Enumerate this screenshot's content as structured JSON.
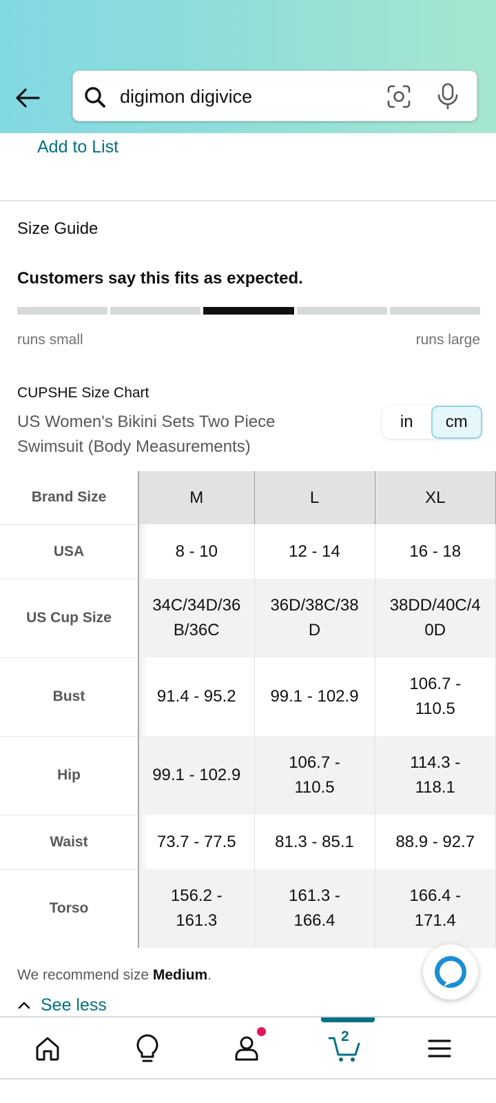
{
  "search": {
    "query": "digimon digivice"
  },
  "product": {
    "add_to_list_label": "Add to List"
  },
  "size_guide": {
    "title": "Size Guide",
    "fit_statement": "Customers say this fits as expected.",
    "fit_scale": {
      "segments": 5,
      "active_segment": 3,
      "left_label": "runs small",
      "right_label": "runs large"
    }
  },
  "size_chart": {
    "brand_title": "CUPSHE Size Chart",
    "description": "US Women's Bikini Sets Two Piece Swimsuit (Body Measurements)",
    "units": [
      "in",
      "cm"
    ],
    "selected_unit": "cm",
    "header": [
      "Brand Size",
      "M",
      "L",
      "XL"
    ],
    "rows": [
      {
        "label": "USA",
        "values": [
          "8 - 10",
          "12 - 14",
          "16 - 18"
        ]
      },
      {
        "label": "US Cup Size",
        "values": [
          "34C/34D/36B/36C",
          "36D/38C/38D",
          "38DD/40C/40D"
        ]
      },
      {
        "label": "Bust",
        "values": [
          "91.4 - 95.2",
          "99.1 - 102.9",
          "106.7 - 110.5"
        ]
      },
      {
        "label": "Hip",
        "values": [
          "99.1 - 102.9",
          "106.7 - 110.5",
          "114.3 - 118.1"
        ]
      },
      {
        "label": "Waist",
        "values": [
          "73.7 - 77.5",
          "81.3 - 85.1",
          "88.9 - 92.7"
        ]
      },
      {
        "label": "Torso",
        "values": [
          "156.2 - 161.3",
          "161.3 - 166.4",
          "166.4 - 171.4"
        ]
      }
    ]
  },
  "recommendation": {
    "prefix": "We recommend size ",
    "size": "Medium",
    "suffix": "."
  },
  "see_less_label": "See less",
  "bottom_nav": {
    "cart_count": "2"
  },
  "colors": {
    "link": "#007185",
    "header_gradient_start": "#82d8e3",
    "header_gradient_end": "#a6e6cf",
    "notification": "#e8135a"
  }
}
